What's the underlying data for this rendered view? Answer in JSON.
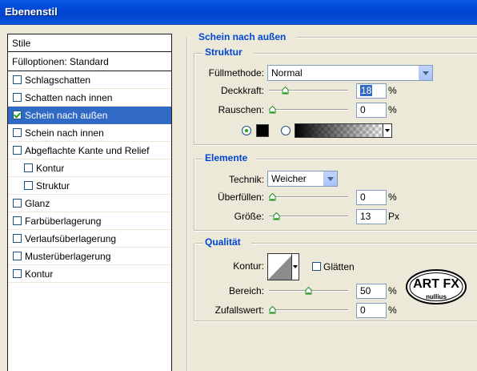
{
  "window": {
    "title": "Ebenenstil"
  },
  "stylelist": {
    "header": "Stile",
    "fill_options": "Fülloptionen: Standard",
    "items": [
      {
        "label": "Schlagschatten",
        "checked": false,
        "sub": false,
        "selected": false
      },
      {
        "label": "Schatten nach innen",
        "checked": false,
        "sub": false,
        "selected": false
      },
      {
        "label": "Schein nach außen",
        "checked": true,
        "sub": false,
        "selected": true
      },
      {
        "label": "Schein nach innen",
        "checked": false,
        "sub": false,
        "selected": false
      },
      {
        "label": "Abgeflachte Kante und Relief",
        "checked": false,
        "sub": false,
        "selected": false
      },
      {
        "label": "Kontur",
        "checked": false,
        "sub": true,
        "selected": false
      },
      {
        "label": "Struktur",
        "checked": false,
        "sub": true,
        "selected": false
      },
      {
        "label": "Glanz",
        "checked": false,
        "sub": false,
        "selected": false
      },
      {
        "label": "Farbüberlagerung",
        "checked": false,
        "sub": false,
        "selected": false
      },
      {
        "label": "Verlaufsüberlagerung",
        "checked": false,
        "sub": false,
        "selected": false
      },
      {
        "label": "Musterüberlagerung",
        "checked": false,
        "sub": false,
        "selected": false
      },
      {
        "label": "Kontur",
        "checked": false,
        "sub": false,
        "selected": false
      }
    ]
  },
  "panel": {
    "title": "Schein nach außen",
    "struktur": {
      "title": "Struktur",
      "fuellmethode": {
        "label": "Füllmethode:",
        "value": "Normal"
      },
      "deckkraft": {
        "label": "Deckkraft:",
        "value": "18",
        "unit": "%",
        "level": 0.18
      },
      "rauschen": {
        "label": "Rauschen:",
        "value": "0",
        "unit": "%",
        "level": 0.0
      },
      "color_mode": "solid",
      "swatch_color": "#000000"
    },
    "elemente": {
      "title": "Elemente",
      "technik": {
        "label": "Technik:",
        "value": "Weicher"
      },
      "ueberfuellen": {
        "label": "Überfüllen:",
        "value": "0",
        "unit": "%",
        "level": 0.0
      },
      "groesse": {
        "label": "Größe:",
        "value": "13",
        "unit": "Px",
        "level": 0.05
      }
    },
    "qualitaet": {
      "title": "Qualität",
      "kontur": {
        "label": "Kontur:"
      },
      "glaetten": {
        "label": "Glätten",
        "checked": false
      },
      "bereich": {
        "label": "Bereich:",
        "value": "50",
        "unit": "%",
        "level": 0.5
      },
      "zufallswert": {
        "label": "Zufallswert:",
        "value": "0",
        "unit": "%",
        "level": 0.0
      }
    }
  },
  "logo": {
    "line1": "ART FX",
    "line2": "nullius"
  },
  "colors": {
    "accent": "#0046d5",
    "selection": "#316ac5",
    "titlebar": "#0054e3"
  }
}
